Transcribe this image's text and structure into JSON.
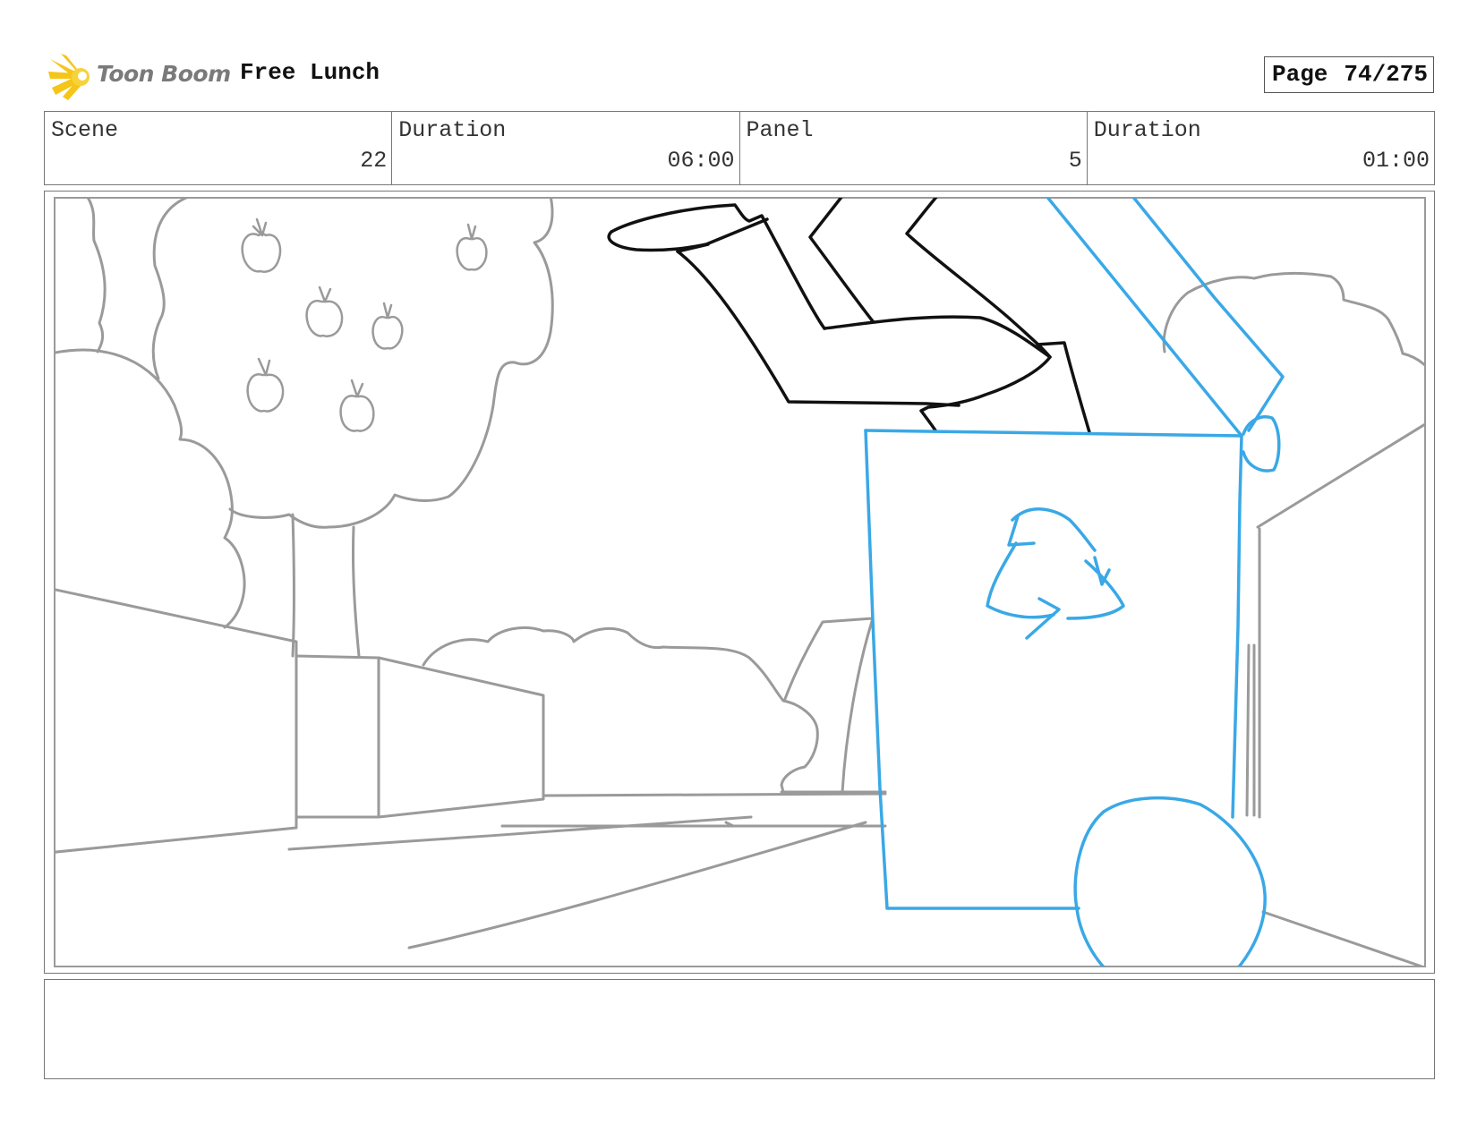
{
  "header": {
    "logo_text": "Toon Boom",
    "project_title": "Free Lunch",
    "page_label": "Page",
    "page_value": "74/275"
  },
  "info": {
    "scene_label": "Scene",
    "scene_value": "22",
    "scene_duration_label": "Duration",
    "scene_duration_value": "06:00",
    "panel_label": "Panel",
    "panel_value": "5",
    "panel_duration_label": "Duration",
    "panel_duration_value": "01:00"
  },
  "colors": {
    "sketch_gray": "#9a9a9a",
    "character_black": "#111111",
    "bin_blue": "#3aa8e6",
    "logo_yellow": "#f5c518"
  },
  "notes": {
    "text": ""
  }
}
